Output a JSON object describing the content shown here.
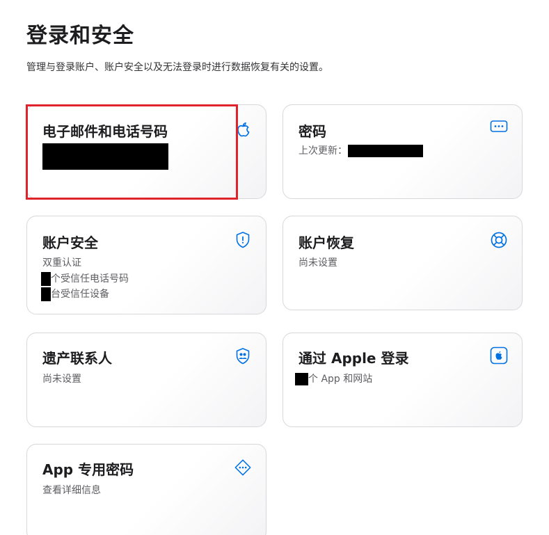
{
  "page": {
    "title": "登录和安全",
    "description": "管理与登录账户、账户安全以及无法登录时进行数据恢复有关的设置。"
  },
  "colors": {
    "accent": "#0071e3",
    "highlight": "#e0232b"
  },
  "cards": {
    "email_phone": {
      "title": "电子邮件和电话号码",
      "icon": "apple-icon"
    },
    "password": {
      "title": "密码",
      "last_updated_label": "上次更新：",
      "icon": "more-icon"
    },
    "account_security": {
      "title": "账户安全",
      "line1": "双重认证",
      "line2": "个受信任电话号码",
      "line3": "台受信任设备",
      "icon": "shield-icon"
    },
    "account_recovery": {
      "title": "账户恢复",
      "line1": "尚未设置",
      "icon": "lifebuoy-icon"
    },
    "legacy_contact": {
      "title": "遗产联系人",
      "line1": "尚未设置",
      "icon": "people-shield-icon"
    },
    "sign_in_apple": {
      "title": "通过 Apple 登录",
      "line1": "个 App 和网站",
      "icon": "apple-square-icon"
    },
    "app_passwords": {
      "title": "App 专用密码",
      "line1": "查看详细信息",
      "icon": "dots-diamond-icon"
    }
  }
}
